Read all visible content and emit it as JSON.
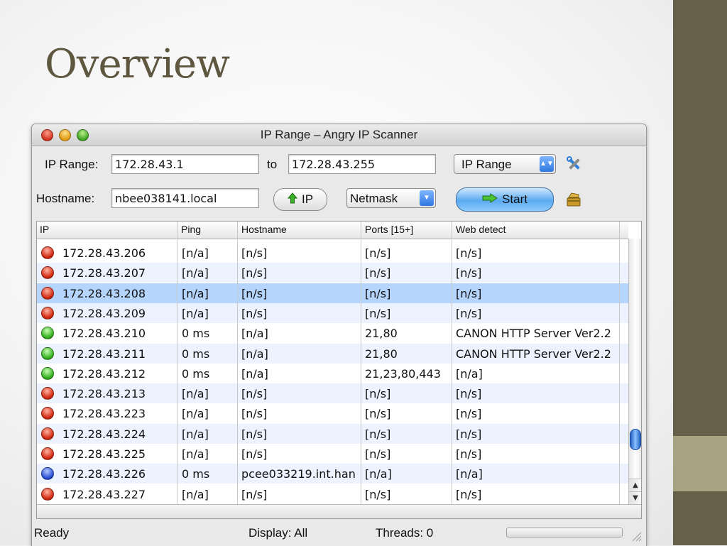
{
  "slide": {
    "title": "Overview"
  },
  "window": {
    "title": "IP Range – Angry IP Scanner"
  },
  "toolbar": {
    "ip_range_label": "IP Range:",
    "ip_from": "172.28.43.1",
    "to_label": "to",
    "ip_to": "172.28.43.255",
    "feeder_select": "IP Range",
    "hostname_label": "Hostname:",
    "hostname_value": "nbee038141.local",
    "ip_button_label": "IP",
    "netmask_select": "Netmask",
    "start_button_label": "Start"
  },
  "table": {
    "columns": [
      "IP",
      "Ping",
      "Hostname",
      "Ports [15+]",
      "Web detect"
    ],
    "rows": [
      {
        "status": "dead",
        "ip": "172.28.43.206",
        "ping": "[n/a]",
        "hostname": "[n/s]",
        "ports": "[n/s]",
        "web": "[n/s]"
      },
      {
        "status": "dead",
        "ip": "172.28.43.207",
        "ping": "[n/a]",
        "hostname": "[n/s]",
        "ports": "[n/s]",
        "web": "[n/s]"
      },
      {
        "status": "dead",
        "ip": "172.28.43.208",
        "ping": "[n/a]",
        "hostname": "[n/s]",
        "ports": "[n/s]",
        "web": "[n/s]",
        "selected": true
      },
      {
        "status": "dead",
        "ip": "172.28.43.209",
        "ping": "[n/a]",
        "hostname": "[n/s]",
        "ports": "[n/s]",
        "web": "[n/s]"
      },
      {
        "status": "alive",
        "ip": "172.28.43.210",
        "ping": "0 ms",
        "hostname": "[n/a]",
        "ports": "21,80",
        "web": "CANON HTTP Server Ver2.2"
      },
      {
        "status": "alive",
        "ip": "172.28.43.211",
        "ping": "0 ms",
        "hostname": "[n/a]",
        "ports": "21,80",
        "web": "CANON HTTP Server Ver2.2"
      },
      {
        "status": "alive",
        "ip": "172.28.43.212",
        "ping": "0 ms",
        "hostname": "[n/a]",
        "ports": "21,23,80,443",
        "web": "[n/a]"
      },
      {
        "status": "dead",
        "ip": "172.28.43.213",
        "ping": "[n/a]",
        "hostname": "[n/s]",
        "ports": "[n/s]",
        "web": "[n/s]"
      },
      {
        "status": "dead",
        "ip": "172.28.43.223",
        "ping": "[n/a]",
        "hostname": "[n/s]",
        "ports": "[n/s]",
        "web": "[n/s]"
      },
      {
        "status": "dead",
        "ip": "172.28.43.224",
        "ping": "[n/a]",
        "hostname": "[n/s]",
        "ports": "[n/s]",
        "web": "[n/s]"
      },
      {
        "status": "dead",
        "ip": "172.28.43.225",
        "ping": "[n/a]",
        "hostname": "[n/s]",
        "ports": "[n/s]",
        "web": "[n/s]"
      },
      {
        "status": "withports",
        "ip": "172.28.43.226",
        "ping": "0 ms",
        "hostname": "pcee033219.int.han",
        "ports": "[n/a]",
        "web": "[n/a]"
      },
      {
        "status": "dead",
        "ip": "172.28.43.227",
        "ping": "[n/a]",
        "hostname": "[n/s]",
        "ports": "[n/s]",
        "web": "[n/s]"
      }
    ]
  },
  "status": {
    "state": "Ready",
    "display": "Display: All",
    "threads": "Threads: 0"
  },
  "colors": {
    "slide_accent": "#665f4a",
    "title_color": "#5e563f",
    "selected_row": "#b5d5fc",
    "alt_row": "#edf3fe"
  },
  "icons": {
    "preferences": "tools-icon",
    "fetchers": "fetchers-icon",
    "up_arrow": "green-up-arrow-icon",
    "start_arrow": "green-right-arrow-icon"
  }
}
